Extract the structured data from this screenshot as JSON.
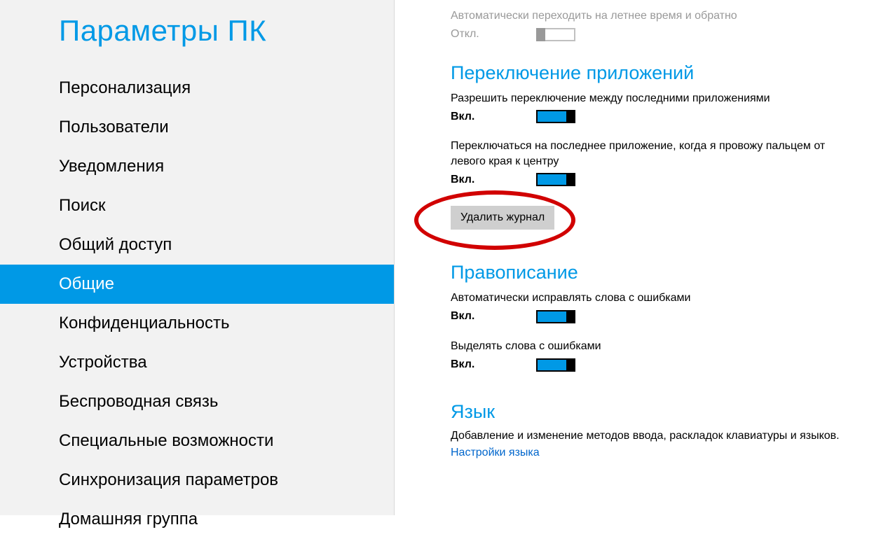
{
  "sidebar": {
    "title": "Параметры ПК",
    "items": [
      "Персонализация",
      "Пользователи",
      "Уведомления",
      "Поиск",
      "Общий доступ",
      "Общие",
      "Конфиденциальность",
      "Устройства",
      "Беспроводная связь",
      "Специальные возможности",
      "Синхронизация параметров",
      "Домашняя группа"
    ],
    "selectedIndex": 5
  },
  "dst": {
    "desc": "Автоматически переходить на летнее время и обратно",
    "state": "Откл."
  },
  "appSwitching": {
    "title": "Переключение приложений",
    "allowRecent": {
      "desc": "Разрешить переключение между последними приложениями",
      "state": "Вкл."
    },
    "swipeLastApp": {
      "desc": "Переключаться на последнее приложение, когда я провожу пальцем от левого края к центру",
      "state": "Вкл."
    },
    "deleteHistoryBtn": "Удалить журнал"
  },
  "spelling": {
    "title": "Правописание",
    "autocorrect": {
      "desc": "Автоматически исправлять слова с ошибками",
      "state": "Вкл."
    },
    "highlight": {
      "desc": "Выделять слова с ошибками",
      "state": "Вкл."
    }
  },
  "language": {
    "title": "Язык",
    "desc": "Добавление и изменение методов ввода, раскладок клавиатуры и языков.",
    "link": "Настройки языка"
  }
}
